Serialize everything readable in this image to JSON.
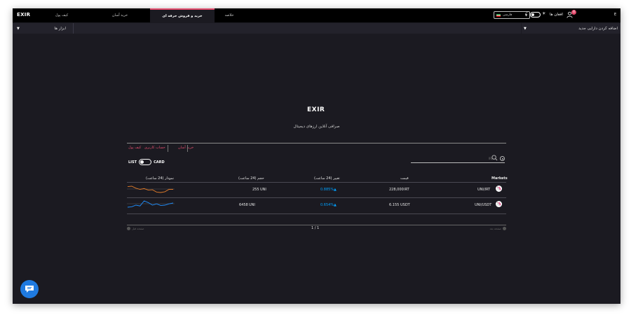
{
  "app": {
    "logo": "EXIR",
    "user_label": "افغان ها",
    "notifications": "4",
    "language": "فارسی",
    "edge_mark": "E"
  },
  "tabs": [
    {
      "label": "کیف پول",
      "active": false
    },
    {
      "label": "خرید آسان",
      "active": false
    },
    {
      "label": "خرید و فروش حرفه ای",
      "active": true
    },
    {
      "label": "خلاصه",
      "active": false
    }
  ],
  "panels": {
    "tools_label": "ابزار ها",
    "add_asset_label": "اضافه کردن دارایی جدید"
  },
  "hero": {
    "brand": "EXIR",
    "tagline": "صرافی آنلاین ارزهای دیجیتال"
  },
  "quick_links": [
    "خرید آسان",
    "حساب کاربری",
    "کیف پول"
  ],
  "search": {
    "placeholder": "IRL"
  },
  "view_toggle": {
    "list": "LIST",
    "card": "CARD"
  },
  "table": {
    "headers": {
      "market": "Markets",
      "price": "قیمت",
      "change": "تغییر (24 ساعت)",
      "volume": "حجم (24 ساعت)",
      "chart": "نمودار (24 ساعت)"
    },
    "rows": [
      {
        "market": "UNI/IRT",
        "price": "228,000",
        "price_unit": "IRT",
        "change": "0.885%",
        "volume": "255",
        "volume_unit": "UNI"
      },
      {
        "market": "UNI/USDT",
        "price": "6.155",
        "price_unit": "USDT",
        "change": "0.654%",
        "volume": "6458",
        "volume_unit": "UNI"
      }
    ],
    "sparklines": [
      {
        "color": "#e07b2a",
        "values": [
          6,
          6.2,
          5.2,
          4.6,
          5,
          4.2,
          4.4,
          3.2,
          3,
          3.4,
          4.6,
          4.6
        ]
      },
      {
        "color": "#1f8fff",
        "values": [
          3,
          3.2,
          4,
          3.6,
          6,
          5.2,
          4,
          4.6,
          3.8,
          4,
          4.6,
          5
        ]
      }
    ]
  },
  "pagination": {
    "label": "1 / 1",
    "prev": "صفحه قبل",
    "next": "صفحه بعد"
  },
  "colors": {
    "accent": "#e44d6e",
    "positive": "#00a1ff",
    "background": "#1b1a21",
    "chat": "#1f7ae0"
  }
}
